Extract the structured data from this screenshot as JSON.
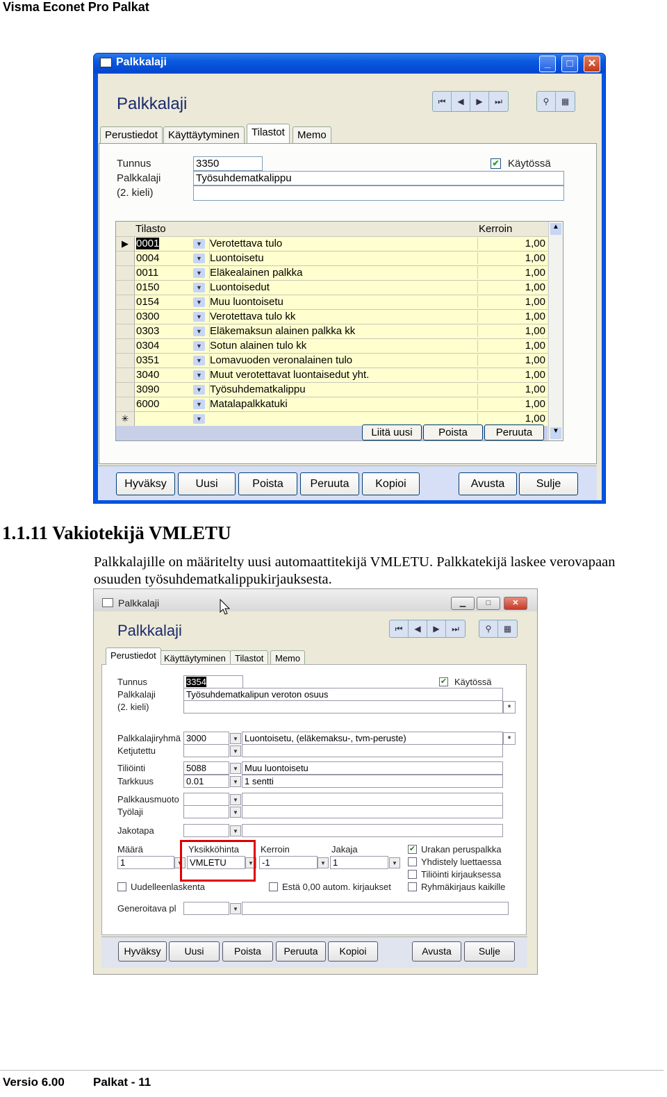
{
  "header": {
    "title": "Visma Econet Pro Palkat"
  },
  "footer": {
    "version": "Versio 6.00",
    "page": "Palkat - 11"
  },
  "section": {
    "heading": "1.1.11 Vakiotekijä VMLETU",
    "paragraph": "Palkkalajille on määritelty uusi automaattitekijä VMLETU. Palkkatekijä laskee verovapaan osuuden työsuhdematkalippukirjauksesta."
  },
  "window1": {
    "title": "Palkkalaji",
    "form_title": "Palkkalaji",
    "tabs": [
      "Perustiedot",
      "Käyttäytyminen",
      "Tilastot",
      "Memo"
    ],
    "active_tab": "Tilastot",
    "labels": {
      "tunnus": "Tunnus",
      "palkkalaji": "Palkkalaji",
      "kieli": "(2. kieli)",
      "kaytossa": "Käytössä"
    },
    "values": {
      "tunnus": "3350",
      "palkkalaji": "Työsuhdematkalippu",
      "kieli": "",
      "kaytossa": true
    },
    "grid": {
      "col_tilasto": "Tilasto",
      "col_kerroin": "Kerroin",
      "rows": [
        {
          "code": "0001",
          "name": "Verotettava tulo",
          "kerroin": "1,00"
        },
        {
          "code": "0004",
          "name": "Luontoisetu",
          "kerroin": "1,00"
        },
        {
          "code": "0011",
          "name": "Eläkealainen palkka",
          "kerroin": "1,00"
        },
        {
          "code": "0150",
          "name": "Luontoisedut",
          "kerroin": "1,00"
        },
        {
          "code": "0154",
          "name": "Muu luontoisetu",
          "kerroin": "1,00"
        },
        {
          "code": "0300",
          "name": "Verotettava tulo kk",
          "kerroin": "1,00"
        },
        {
          "code": "0303",
          "name": "Eläkemaksun alainen palkka kk",
          "kerroin": "1,00"
        },
        {
          "code": "0304",
          "name": "Sotun alainen tulo kk",
          "kerroin": "1,00"
        },
        {
          "code": "0351",
          "name": "Lomavuoden veronalainen tulo",
          "kerroin": "1,00"
        },
        {
          "code": "3040",
          "name": "Muut verotettavat luontaisedut yht.",
          "kerroin": "1,00"
        },
        {
          "code": "3090",
          "name": "Työsuhdematkalippu",
          "kerroin": "1,00"
        },
        {
          "code": "6000",
          "name": "Matalapalkkatuki",
          "kerroin": "1,00"
        },
        {
          "code": "",
          "name": "",
          "kerroin": "1,00"
        }
      ],
      "new_row_marker": "✳",
      "current_row_marker": "▶",
      "buttons": [
        "Liitä uusi",
        "Poista",
        "Peruuta"
      ]
    },
    "buttons": [
      "Hyväksy",
      "Uusi",
      "Poista",
      "Peruuta",
      "Kopioi",
      "Avusta",
      "Sulje"
    ]
  },
  "window2": {
    "title": "Palkkalaji",
    "form_title": "Palkkalaji",
    "tabs": [
      "Perustiedot",
      "Käyttäytyminen",
      "Tilastot",
      "Memo"
    ],
    "active_tab": "Perustiedot",
    "labels": {
      "tunnus": "Tunnus",
      "palkkalaji": "Palkkalaji",
      "kieli": "(2. kieli)",
      "kaytossa": "Käytössä",
      "palkkalajiryhma": "Palkkalajiryhmä",
      "ketjutettu": "Ketjutettu",
      "tiliointi": "Tiliöinti",
      "tarkkuus": "Tarkkuus",
      "palkkausmuoto": "Palkkausmuoto",
      "tyolaji": "Työlaji",
      "jakotapa": "Jakotapa",
      "maara": "Määrä",
      "yksikkohinta": "Yksikköhinta",
      "kerroin": "Kerroin",
      "jakaja": "Jakaja",
      "uudelleenlaskenta": "Uudelleenlaskenta",
      "esta": "Estä 0,00 autom. kirjaukset",
      "urakan": "Urakan peruspalkka",
      "yhdistely": "Yhdistely luettaessa",
      "tiliointi_kirjauksessa": "Tiliöinti kirjauksessa",
      "ryhmakirjaus": "Ryhmäkirjaus kaikille",
      "generoitava": "Generoitava pl"
    },
    "values": {
      "tunnus": "3354",
      "palkkalaji": "Työsuhdematkalipun veroton osuus",
      "palkkalajiryhma_code": "3000",
      "palkkalajiryhma_name": "Luontoisetu, (eläkemaksu-, tvm-peruste)",
      "tiliointi_code": "5088",
      "tiliointi_name": "Muu luontoisetu",
      "tarkkuus_code": "0.01",
      "tarkkuus_name": "1 sentti",
      "maara": "1",
      "yksikkohinta": "VMLETU",
      "kerroin": "-1",
      "jakaja": "1",
      "kaytossa": true,
      "urakan": true,
      "yhdistely": false,
      "tiliointi_kirjauksessa": false,
      "ryhmakirjaus": false,
      "uudelleenlaskenta": false,
      "esta": false
    },
    "star": "*",
    "buttons": [
      "Hyväksy",
      "Uusi",
      "Poista",
      "Peruuta",
      "Kopioi",
      "Avusta",
      "Sulje"
    ]
  },
  "colors": {
    "highlight": "#e00000",
    "xp_title": "#0054e3",
    "grid_row": "#fefece"
  }
}
